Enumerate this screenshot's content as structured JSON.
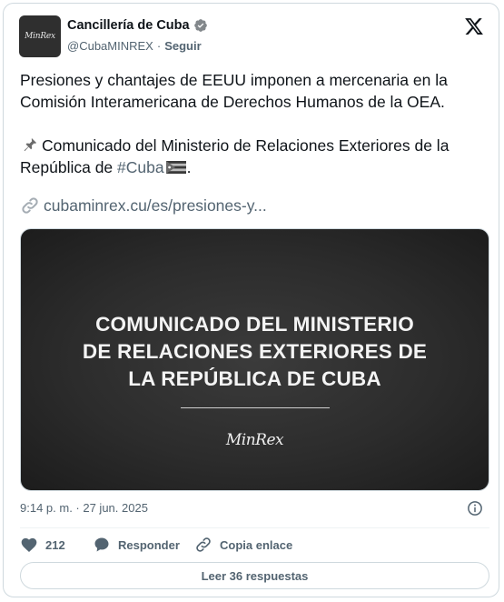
{
  "author": {
    "name": "Cancillería de Cuba",
    "handle": "@CubaMINREX",
    "separator": "·",
    "follow_label": "Seguir",
    "avatar_text": "MinRex"
  },
  "post": {
    "paragraph1": "Presiones y chantajes de EEUU imponen a mercenaria en la Comisión Interamericana de Derechos Humanos de la OEA.",
    "paragraph2_text": "Comunicado del Ministerio de Relaciones Exteriores de la República de ",
    "hashtag": "#Cuba",
    "paragraph2_end": ".",
    "link_text": "cubaminrex.cu/es/presiones-y..."
  },
  "media": {
    "line1": "COMUNICADO DEL MINISTERIO",
    "line2": "DE RELACIONES EXTERIORES DE",
    "line3": "LA REPÚBLICA DE CUBA",
    "logo_text": "MinRex"
  },
  "meta": {
    "timestamp": "9:14 p. m. · 27 jun. 2025"
  },
  "actions": {
    "likes_count": "212",
    "reply_label": "Responder",
    "copy_link_label": "Copia enlace"
  },
  "read_replies_label": "Leer 36 respuestas",
  "icons": [
    "verified-icon",
    "x-logo-icon",
    "pin-icon",
    "cuba-flag-icon",
    "link-icon",
    "info-icon",
    "heart-icon",
    "reply-icon",
    "copy-link-icon"
  ]
}
